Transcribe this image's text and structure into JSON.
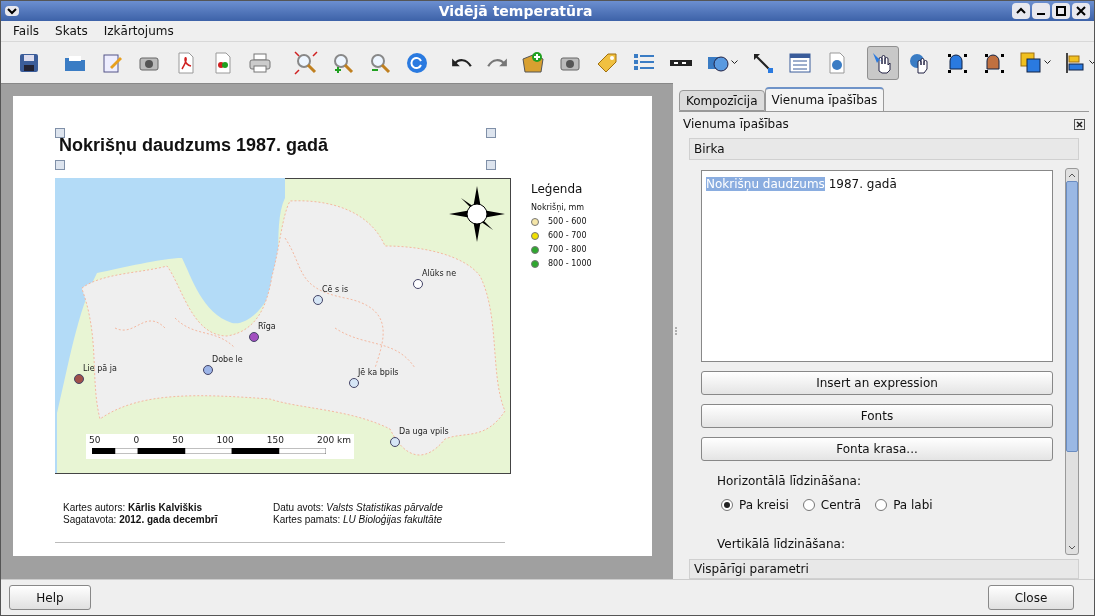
{
  "window": {
    "title": "Vidējā temperatūra"
  },
  "menu": [
    "Fails",
    "Skats",
    "Izkārtojums"
  ],
  "tools": [
    {
      "kind": "save",
      "selected": false
    },
    {
      "kind": "sep"
    },
    {
      "kind": "open",
      "selected": false
    },
    {
      "kind": "edit",
      "selected": false
    },
    {
      "kind": "camera",
      "selected": false
    },
    {
      "kind": "pdf",
      "selected": false
    },
    {
      "kind": "svg",
      "selected": false
    },
    {
      "kind": "print",
      "selected": false
    },
    {
      "kind": "sep"
    },
    {
      "kind": "zoomfit",
      "selected": false
    },
    {
      "kind": "zoomin",
      "selected": false
    },
    {
      "kind": "zoomout",
      "selected": false
    },
    {
      "kind": "refresh",
      "selected": false
    },
    {
      "kind": "sep"
    },
    {
      "kind": "undo",
      "selected": false
    },
    {
      "kind": "redo",
      "selected": false
    },
    {
      "kind": "addmap",
      "selected": false
    },
    {
      "kind": "image",
      "selected": false
    },
    {
      "kind": "label",
      "selected": false
    },
    {
      "kind": "legend",
      "selected": false
    },
    {
      "kind": "scalebar",
      "selected": false
    },
    {
      "kind": "shape",
      "selected": false
    },
    {
      "kind": "arrow",
      "selected": false
    },
    {
      "kind": "table",
      "selected": false
    },
    {
      "kind": "html",
      "selected": false
    },
    {
      "kind": "sep"
    },
    {
      "kind": "select",
      "selected": true
    },
    {
      "kind": "pan",
      "selected": false
    },
    {
      "kind": "move",
      "selected": false
    },
    {
      "kind": "movecontent",
      "selected": false
    },
    {
      "kind": "raise",
      "selected": false
    },
    {
      "kind": "align",
      "selected": false
    }
  ],
  "page": {
    "title": "Nokrišņu daudzums 1987. gadā",
    "cities": [
      {
        "name": "Lie pā ja",
        "color": "#a0504a"
      },
      {
        "name": "Dobe le",
        "color": "#9db5e8"
      },
      {
        "name": "Rīga",
        "color": "#a24fc0"
      },
      {
        "name": "Cē s is",
        "color": "#d6e6f6"
      },
      {
        "name": "Alūks ne",
        "color": "#ffffff"
      },
      {
        "name": "Jē ka bpils",
        "color": "#d6e6f6"
      },
      {
        "name": "Da uga vpils",
        "color": "#d6e6f6"
      }
    ],
    "scale_labels": [
      "50",
      "0",
      "50",
      "100",
      "150",
      "200 km"
    ],
    "legend": {
      "title": "Leģenda",
      "subtitle": "Nokrišņi, mm",
      "items": [
        {
          "label": "500 - 600",
          "color": "#f5e6a8"
        },
        {
          "label": "600 - 700",
          "color": "#f0e000"
        },
        {
          "label": "700 - 800",
          "color": "#2ea82e"
        },
        {
          "label": "800 - 1000",
          "color": "#2ea82e"
        }
      ]
    },
    "credits": [
      "Kartes autors: **Kārlis Kalviškis**",
      "Datu avots: *Valsts Statistikas pārvalde*",
      "Sagatavota: **2012. gada decembrī**",
      "Kartes pamats: *LU Bioloģijas fakultāte*"
    ]
  },
  "tabs": [
    {
      "label": "Kompozīcija",
      "selected": false
    },
    {
      "label": "Vienuma īpašības",
      "selected": true
    }
  ],
  "panel": {
    "title": "Vienuma īpašības",
    "section": "Birka",
    "text_selected": "Nokrišņu daudzums",
    "text_rest": " 1987. gadā",
    "buttons": [
      "Insert an expression",
      "Fonts",
      "Fonta krasa..."
    ],
    "halign_label": "Horizontālā līdzināšana:",
    "halign": [
      {
        "label": "Pa kreisi",
        "selected": true
      },
      {
        "label": "Centrā",
        "selected": false
      },
      {
        "label": "Pa labi",
        "selected": false
      }
    ],
    "valign_label": "Vertikālā līdzināšana:",
    "next_section": "Vispārīgi parametri"
  },
  "footer": {
    "help": "Help",
    "close": "Close"
  }
}
